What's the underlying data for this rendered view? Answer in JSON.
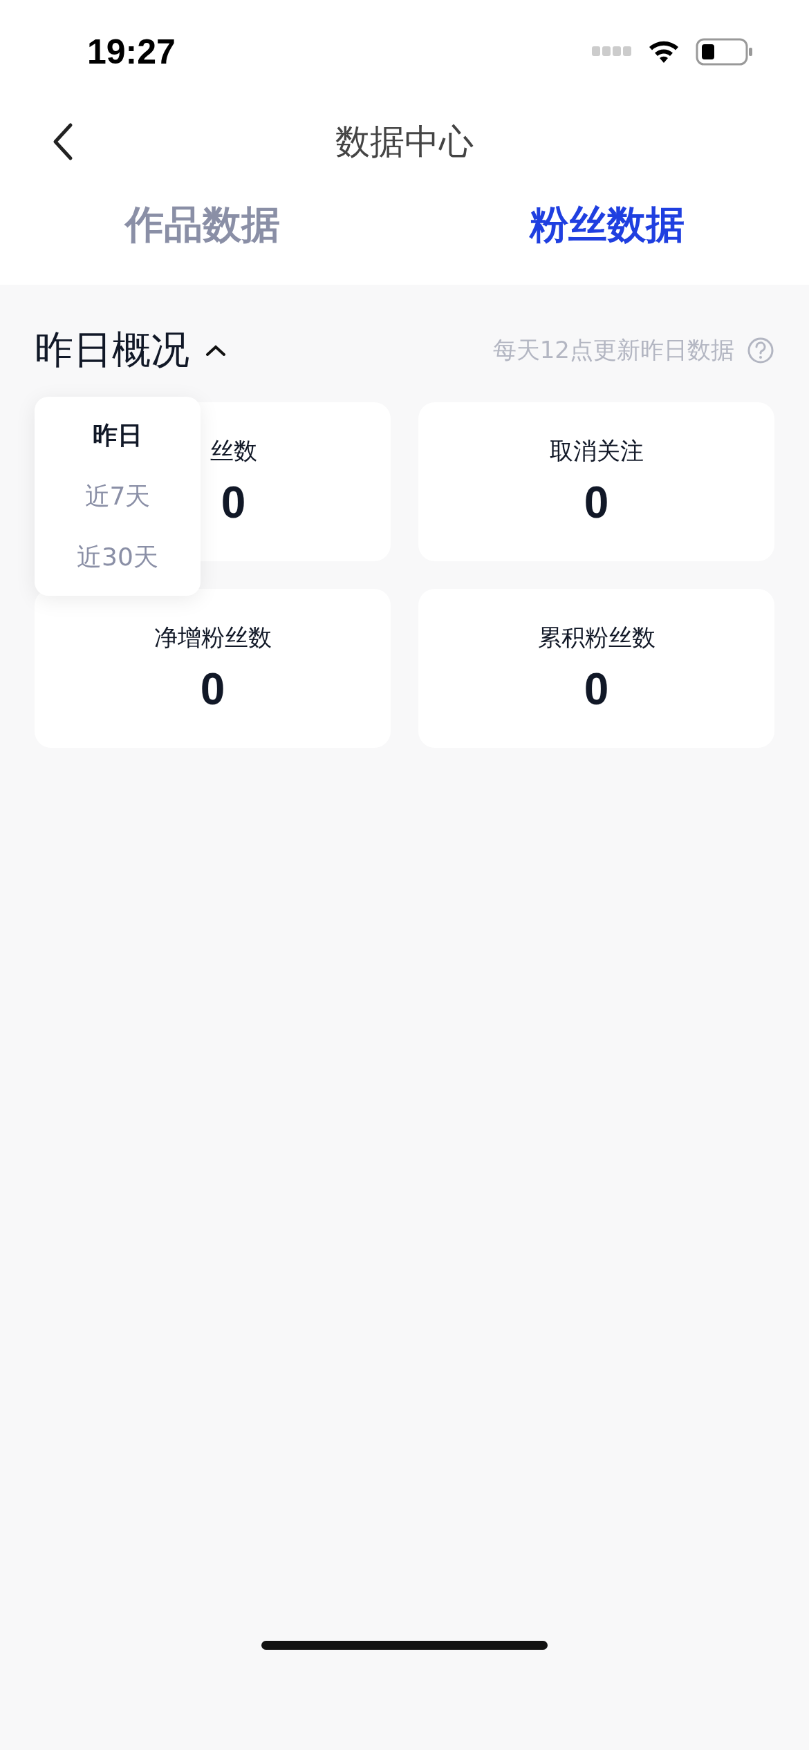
{
  "status_bar": {
    "time": "19:27"
  },
  "nav": {
    "title": "数据中心"
  },
  "tabs": [
    {
      "label": "作品数据",
      "selected": false
    },
    {
      "label": "粉丝数据",
      "selected": true
    }
  ],
  "overview": {
    "title": "昨日概况",
    "expanded": true,
    "note": "每天12点更新昨日数据"
  },
  "period_menu": [
    {
      "label": "昨日",
      "selected": true
    },
    {
      "label": "近7天",
      "selected": false
    },
    {
      "label": "近30天",
      "selected": false
    }
  ],
  "cards": [
    {
      "label": "丝数",
      "value": "0"
    },
    {
      "label": "取消关注",
      "value": "0"
    },
    {
      "label": "净增粉丝数",
      "value": "0"
    },
    {
      "label": "累积粉丝数",
      "value": "0"
    }
  ]
}
